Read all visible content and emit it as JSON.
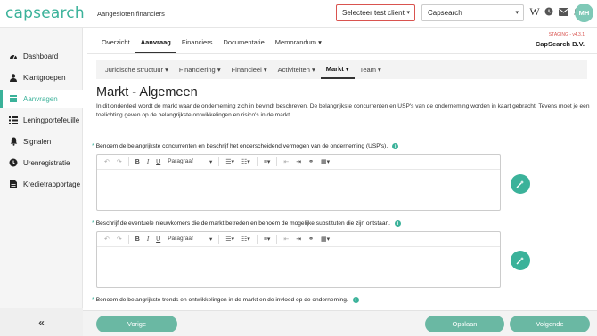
{
  "app": {
    "logo": "capsearch",
    "context": "Aangesloten financiers"
  },
  "header": {
    "client_select": "Selecteer test client",
    "company_select": "Capsearch",
    "icons": [
      "w-icon",
      "clock-icon",
      "mail-icon",
      "bell-icon"
    ],
    "avatar": "MH"
  },
  "sidebar": {
    "items": [
      {
        "label": "Dashboard",
        "icon": "dashboard-icon"
      },
      {
        "label": "Klantgroepen",
        "icon": "users-icon"
      },
      {
        "label": "Aanvragen",
        "icon": "layers-icon",
        "active": true
      },
      {
        "label": "Leningportefeuille",
        "icon": "list-icon"
      },
      {
        "label": "Signalen",
        "icon": "bell-icon"
      },
      {
        "label": "Urenregistratie",
        "icon": "clock-icon"
      },
      {
        "label": "Kredietrapportage",
        "icon": "document-icon"
      }
    ],
    "collapse": "«"
  },
  "tabs": [
    {
      "label": "Overzicht"
    },
    {
      "label": "Aanvraag",
      "active": true
    },
    {
      "label": "Financiers"
    },
    {
      "label": "Documentatie"
    },
    {
      "label": "Memorandum ▾"
    }
  ],
  "env": {
    "staging": "STAGING - v4.3.1",
    "company": "CapSearch B.V."
  },
  "subtabs": [
    {
      "label": "Juridische structuur ▾"
    },
    {
      "label": "Financiering ▾"
    },
    {
      "label": "Financieel ▾"
    },
    {
      "label": "Activiteiten ▾"
    },
    {
      "label": "Markt ▾",
      "active": true
    },
    {
      "label": "Team ▾"
    }
  ],
  "main": {
    "title": "Markt - Algemeen",
    "intro": "In dit onderdeel wordt de markt waar de onderneming zich in bevindt beschreven. De belangrijkste concurrenten en USP's van de onderneming worden in kaart gebracht. Tevens moet je een toelichting geven op de belangrijkste ontwikkelingen en risico's in de markt.",
    "questions": [
      {
        "label": "Benoem de belangrijkste concurrenten en beschrijf het onderscheidend vermogen van de onderneming (USP's).",
        "required": true
      },
      {
        "label": "Beschrijf de eventuele nieuwkomers die de markt betreden en benoem de mogelijke substituten die zijn ontstaan.",
        "required": true
      },
      {
        "label": "Benoem de belangrijkste trends en ontwikkelingen in de markt en de invloed op de onderneming.",
        "required": true
      }
    ],
    "editor": {
      "paragraph": "Paragraaf"
    }
  },
  "footer": {
    "prev": "Vorige",
    "save": "Opslaan",
    "next": "Volgende"
  },
  "colors": {
    "accent": "#3bb29a",
    "button": "#6ab8a3",
    "alert": "#d9534f"
  }
}
